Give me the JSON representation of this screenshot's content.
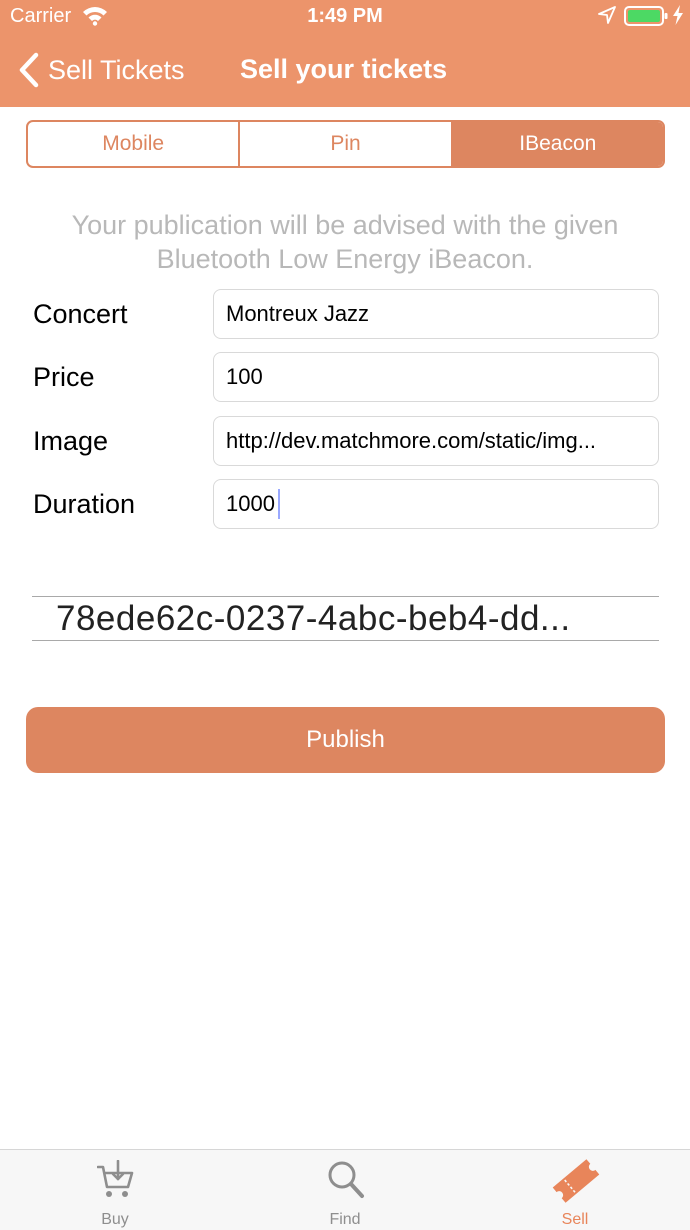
{
  "status_bar": {
    "carrier": "Carrier",
    "time": "1:49 PM",
    "icons": [
      "wifi-icon",
      "location-icon",
      "battery-icon",
      "charge-icon"
    ],
    "battery_color": "#4cd964"
  },
  "nav": {
    "back_label": "Sell Tickets",
    "back_icon": "chevron-left-icon",
    "title": "Sell your tickets"
  },
  "colors": {
    "header": "#ec946b",
    "accent": "#dd8660",
    "info_text": "#b8b8b8"
  },
  "segments": [
    {
      "label": "Mobile",
      "selected": false
    },
    {
      "label": "Pin",
      "selected": false
    },
    {
      "label": "IBeacon",
      "selected": true
    }
  ],
  "info_text": "Your publication will be advised with the given Bluetooth Low Energy iBeacon.",
  "form": {
    "concert": {
      "label": "Concert",
      "value": "Montreux Jazz"
    },
    "price": {
      "label": "Price",
      "value": "100"
    },
    "image": {
      "label": "Image",
      "value": "http://dev.matchmore.com/static/img..."
    },
    "duration": {
      "label": "Duration",
      "value": "1000"
    }
  },
  "beacon_uuid": "78ede62c-0237-4abc-beb4-dd...",
  "publish_label": "Publish",
  "tabs": [
    {
      "label": "Buy",
      "icon": "cart-icon",
      "selected": false
    },
    {
      "label": "Find",
      "icon": "search-icon",
      "selected": false
    },
    {
      "label": "Sell",
      "icon": "ticket-icon",
      "selected": true
    }
  ]
}
